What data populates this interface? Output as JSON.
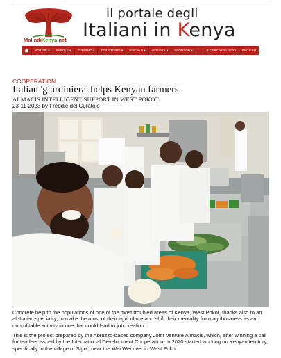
{
  "header": {
    "logo_text_a": "Malindi",
    "logo_text_b": "Kenya",
    "logo_text_c": ".net",
    "site_title_top": "il portale degli",
    "site_title_a": "Italiani in ",
    "site_title_b": "K",
    "site_title_c": "enya"
  },
  "nav": {
    "items": [
      "NOTIZIE",
      "PAROLE",
      "TURISMO",
      "TERRITORIO",
      "SOCIALE",
      "ATTIVITÀ",
      "SPONSOR"
    ],
    "search_label": "CERCA NEL SITO",
    "language_label": "ENGLISH"
  },
  "article": {
    "category": "COOPERATION",
    "title": "Italian 'giardiniera' helps Kenyan farmers",
    "subtitle": "ALMACIS INTELLIGENT SUPPORT IN WEST POKOT",
    "byline": "23-11-2023 by Freddie del Curatolo",
    "paragraph_1": "Concrete help to the populations of one of the most troubled areas of Kenya, West Pokot, thanks also to an all-Italian speciality, to make the most of their agriculture and shift their mentality from agribusiness as an unprofitable activity to one that could lead to job creation.",
    "paragraph_2": "This is the project prepared by the Abruzzo-based company Joint Venture Almacis, which, after winning a call for tenders issued by the International Development Cooperation, in 2020 started working on Kenyan territory, specifically in the village of Sigor, near the Wei Wei river in West Pokot"
  },
  "colors": {
    "brand_red": "#b7241c",
    "category_red": "#c0281e"
  }
}
